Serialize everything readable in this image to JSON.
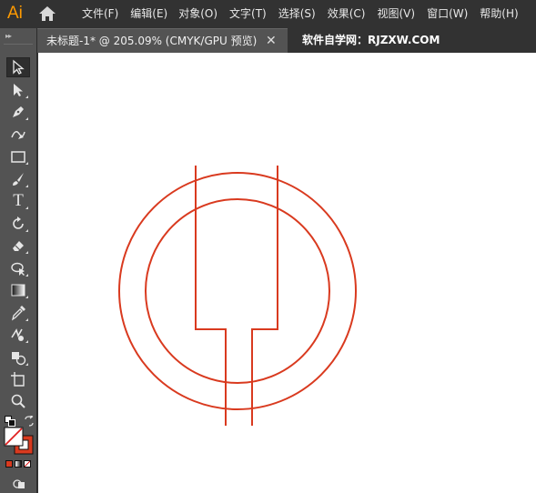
{
  "app": {
    "logo": "Ai",
    "brand_color": "#ff9a00"
  },
  "menu": {
    "items": [
      {
        "label": "文件(F)"
      },
      {
        "label": "编辑(E)"
      },
      {
        "label": "对象(O)"
      },
      {
        "label": "文字(T)"
      },
      {
        "label": "选择(S)"
      },
      {
        "label": "效果(C)"
      },
      {
        "label": "视图(V)"
      },
      {
        "label": "窗口(W)"
      },
      {
        "label": "帮助(H)"
      }
    ]
  },
  "document_tab": {
    "title": "未标题-1* @ 205.09% (CMYK/GPU 预览)",
    "close_symbol": "✕",
    "watermark": "软件自学网：RJZXW.COM"
  },
  "toolbar": {
    "grip": "▸▸",
    "tools": [
      {
        "name": "selection-tool-icon"
      },
      {
        "name": "direct-selection-tool-icon"
      },
      {
        "name": "pen-tool-icon"
      },
      {
        "name": "curvature-tool-icon"
      },
      {
        "name": "rectangle-tool-icon"
      },
      {
        "name": "paintbrush-tool-icon"
      },
      {
        "name": "type-tool-icon"
      },
      {
        "name": "rotate-tool-icon"
      },
      {
        "name": "eraser-tool-icon"
      },
      {
        "name": "puppet-warp-tool-icon"
      },
      {
        "name": "gradient-tool-icon"
      },
      {
        "name": "eyedropper-tool-icon"
      },
      {
        "name": "blend-tool-icon"
      },
      {
        "name": "shape-builder-tool-icon"
      },
      {
        "name": "artboard-tool-icon"
      },
      {
        "name": "zoom-tool-icon"
      }
    ],
    "type_tool_label": "T",
    "fill_color": "#ffffff",
    "stroke_color": "#d93a1f"
  },
  "artwork": {
    "stroke_color": "#d93a1f"
  }
}
